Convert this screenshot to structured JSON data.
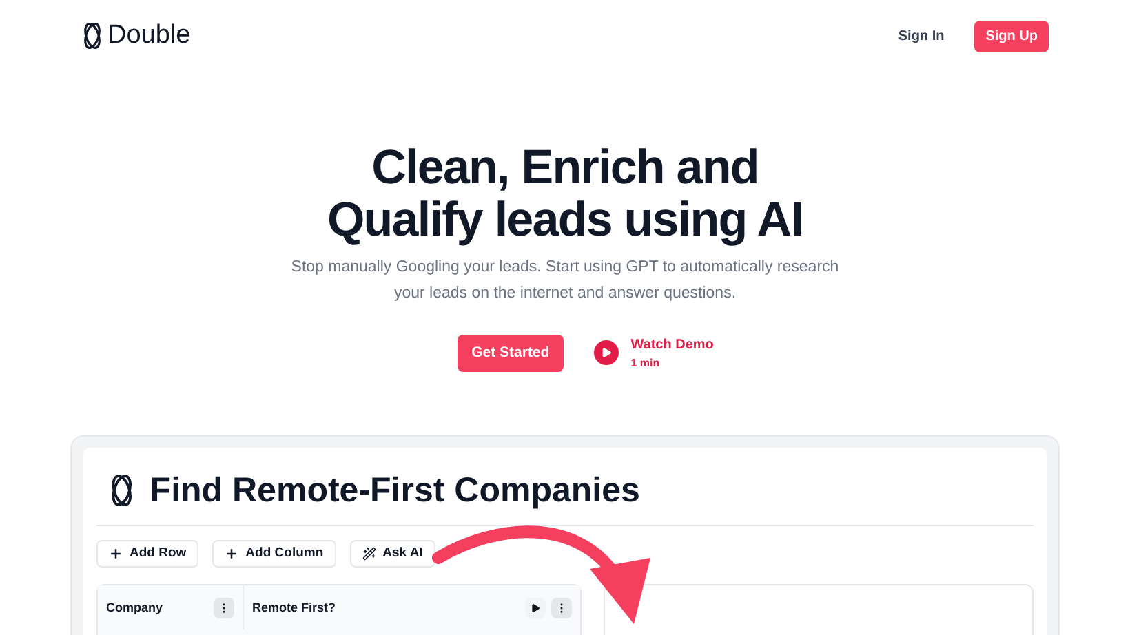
{
  "brand": "Double",
  "nav": [
    {
      "label": "Sign In",
      "kind": "link"
    },
    {
      "label": "Sign Up",
      "kind": "primary"
    }
  ],
  "hero": {
    "title_lines": [
      "Clean, Enrich and",
      "Qualify leads using AI"
    ],
    "subtitle": "Stop manually Googling your leads. Start using GPT to automatically research your leads on the internet and answer questions.",
    "cta": "Get Started",
    "demo": {
      "label": "Watch Demo",
      "duration": "1 min"
    }
  },
  "app": {
    "title": "Find Remote-First Companies",
    "toolbar": [
      {
        "label": "Add Row",
        "kind": "plus"
      },
      {
        "label": "Add Column",
        "kind": "plus"
      },
      {
        "label": "Ask AI",
        "kind": "ai"
      }
    ],
    "columns": [
      {
        "label": "Company",
        "run": false
      },
      {
        "label": "Remote First?",
        "run": true
      }
    ]
  }
}
